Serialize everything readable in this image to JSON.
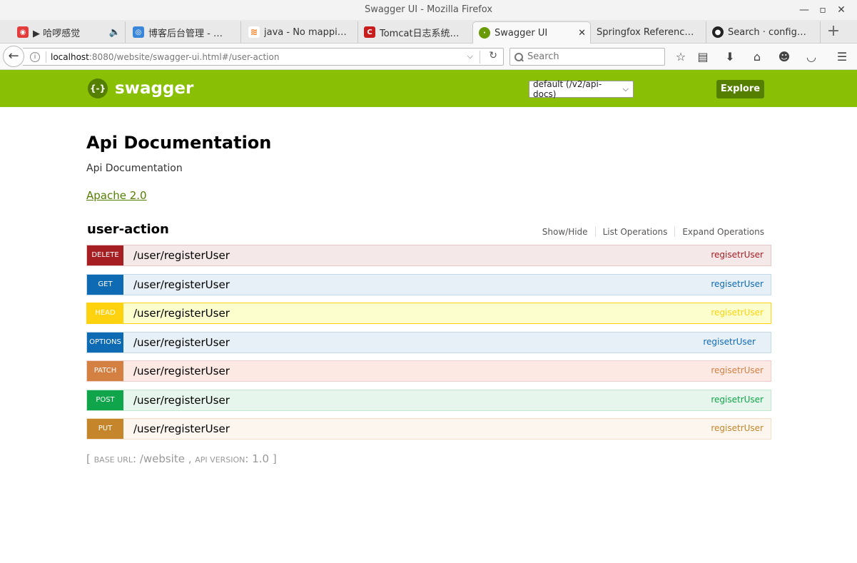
{
  "window": {
    "title": "Swagger UI - Mozilla Firefox"
  },
  "tabs": [
    {
      "label": "▶ 哈啰感觉",
      "icon": "netease-music-icon",
      "color": "#e23c3c"
    },
    {
      "label": "博客后台管理 - …",
      "icon": "blog-icon",
      "color": "#3a86d8"
    },
    {
      "label": "java - No mappi…",
      "icon": "stackoverflow-icon",
      "color": "#f48024"
    },
    {
      "label": "Tomcat日志系统…",
      "icon": "csdn-icon",
      "color": "#c81e1e"
    },
    {
      "label": "Swagger UI",
      "icon": "swagger-favicon",
      "color": "#6a9a05",
      "active": true,
      "close": "✕"
    },
    {
      "label": "Springfox Referenc…",
      "icon": "none",
      "color": "#ffffff"
    },
    {
      "label": "Search · config…",
      "icon": "github-icon",
      "color": "#222222"
    }
  ],
  "navbar": {
    "url_host": "localhost",
    "url_rest": ":8080/website/swagger-ui.html#/user-action",
    "search_placeholder": "Search"
  },
  "swagger": {
    "logo_text": "swagger",
    "logo_glyph": "{-}",
    "spec_selected": "default (/v2/api-docs)",
    "explore_label": "Explore",
    "header_color": "#89bf04"
  },
  "info": {
    "title": "Api Documentation",
    "description": "Api Documentation",
    "license": "Apache 2.0"
  },
  "resource": {
    "name": "user-action",
    "actions": [
      "Show/Hide",
      "List Operations",
      "Expand Operations"
    ],
    "operations": [
      {
        "method": "DELETE",
        "path": "/user/registerUser",
        "summary": "regisetrUser",
        "color": "#a41e22",
        "bg": "#f5e8e8",
        "border": "#e8c6c7",
        "text": "#a41e22"
      },
      {
        "method": "GET",
        "path": "/user/registerUser",
        "summary": "regisetrUser",
        "color": "#0f6ab4",
        "bg": "#e7f0f7",
        "border": "#c3d9ec",
        "text": "#0f6ab4"
      },
      {
        "method": "HEAD",
        "path": "/user/registerUser",
        "summary": "regisetrUser",
        "color": "#ffd20f",
        "bg": "#fcffcd",
        "border": "#ffd20f",
        "text": "#ffd20f"
      },
      {
        "method": "OPTIONS",
        "path": "/user/registerUser",
        "summary": "regisetrUser",
        "color": "#0f6ab4",
        "bg": "#e7f0f7",
        "border": "#c3d9ec",
        "text": "#0f6ab4"
      },
      {
        "method": "PATCH",
        "path": "/user/registerUser",
        "summary": "regisetrUser",
        "color": "#d38042",
        "bg": "#fce9e3",
        "border": "#f0cecb",
        "text": "#d38042"
      },
      {
        "method": "POST",
        "path": "/user/registerUser",
        "summary": "regisetrUser",
        "color": "#10a54a",
        "bg": "#e7f6ec",
        "border": "#c3e8d1",
        "text": "#10a54a"
      },
      {
        "method": "PUT",
        "path": "/user/registerUser",
        "summary": "regisetrUser",
        "color": "#c5862b",
        "bg": "#fcf6ee",
        "border": "#f0e0ca",
        "text": "#c5862b"
      }
    ]
  },
  "footer": {
    "base_url_label": "BASE URL",
    "base_url": "/website",
    "api_version_label": "API VERSION",
    "api_version": "1.0"
  }
}
